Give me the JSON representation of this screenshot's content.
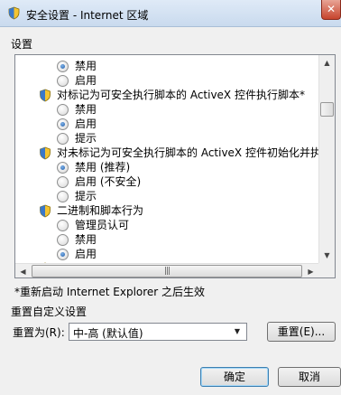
{
  "window": {
    "title": "安全设置 - Internet 区域",
    "close_glyph": "✕"
  },
  "settings_label": "设置",
  "settings_rows": [
    {
      "type": "option",
      "label": "禁用",
      "checked": true
    },
    {
      "type": "option",
      "label": "启用",
      "checked": false
    },
    {
      "type": "setting",
      "label": "对标记为可安全执行脚本的 ActiveX 控件执行脚本*"
    },
    {
      "type": "option",
      "label": "禁用",
      "checked": false
    },
    {
      "type": "option",
      "label": "启用",
      "checked": true
    },
    {
      "type": "option",
      "label": "提示",
      "checked": false
    },
    {
      "type": "setting",
      "label": "对未标记为可安全执行脚本的 ActiveX 控件初始化并执行"
    },
    {
      "type": "option",
      "label": "禁用 (推荐)",
      "checked": true
    },
    {
      "type": "option",
      "label": "启用 (不安全)",
      "checked": false
    },
    {
      "type": "option",
      "label": "提示",
      "checked": false
    },
    {
      "type": "setting",
      "label": "二进制和脚本行为"
    },
    {
      "type": "option",
      "label": "管理员认可",
      "checked": false
    },
    {
      "type": "option",
      "label": "禁用",
      "checked": false
    },
    {
      "type": "option",
      "label": "启用",
      "checked": true
    },
    {
      "type": "setting",
      "label": ""
    }
  ],
  "scrollbar": {
    "up": "▲",
    "down": "▼",
    "left": "◀",
    "right": "▶",
    "grip": "|||"
  },
  "note": "*重新启动 Internet Explorer 之后生效",
  "reset_group_label": "重置自定义设置",
  "reset_to_label": "重置为(R):",
  "reset_combo": {
    "value": "中-高 (默认值)",
    "arrow": "▼"
  },
  "buttons": {
    "reset": "重置(E)...",
    "ok": "确定",
    "cancel": "取消"
  }
}
